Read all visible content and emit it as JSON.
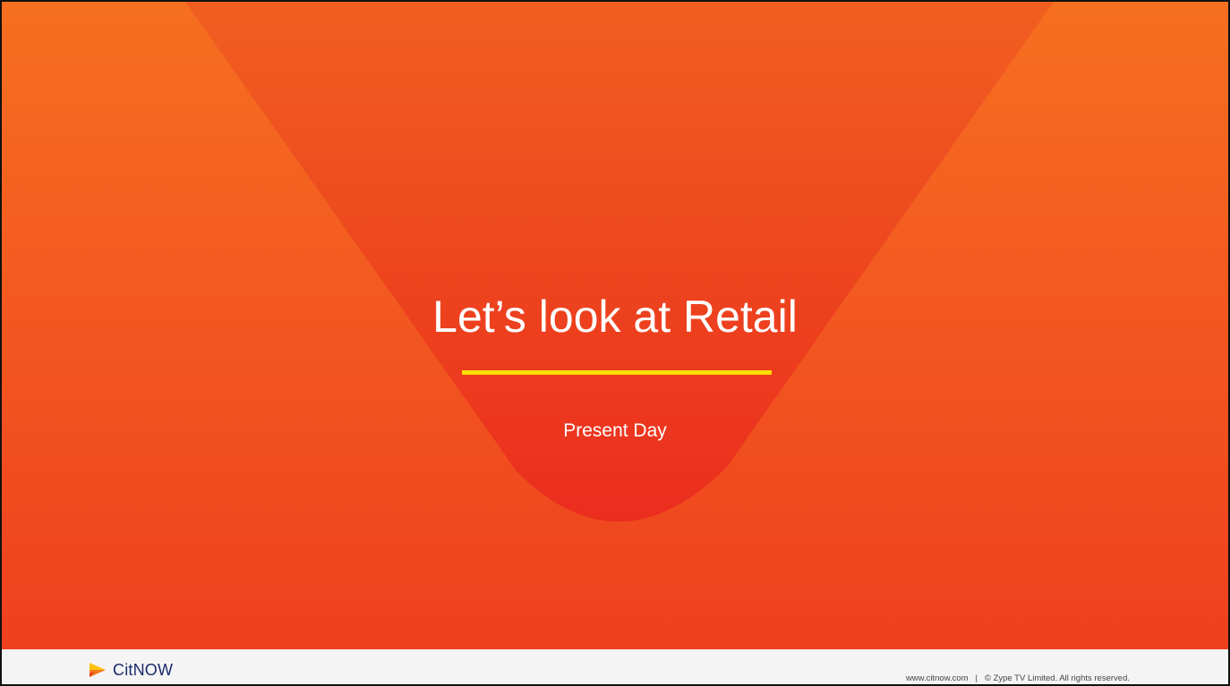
{
  "slide": {
    "title": "Let’s look at Retail",
    "subtitle": "Present Day"
  },
  "footer": {
    "logo_text": "CitNOW",
    "website": "www.citnow.com",
    "separator": "|",
    "copyright": "© Zype TV Limited. All rights reserved."
  },
  "colors": {
    "background_top": "#f4671f",
    "background_bottom": "#ee3a1f",
    "accent_line": "#ffde00",
    "logo_text": "#1b2a6b",
    "footer_bg": "#f4f4f4"
  }
}
